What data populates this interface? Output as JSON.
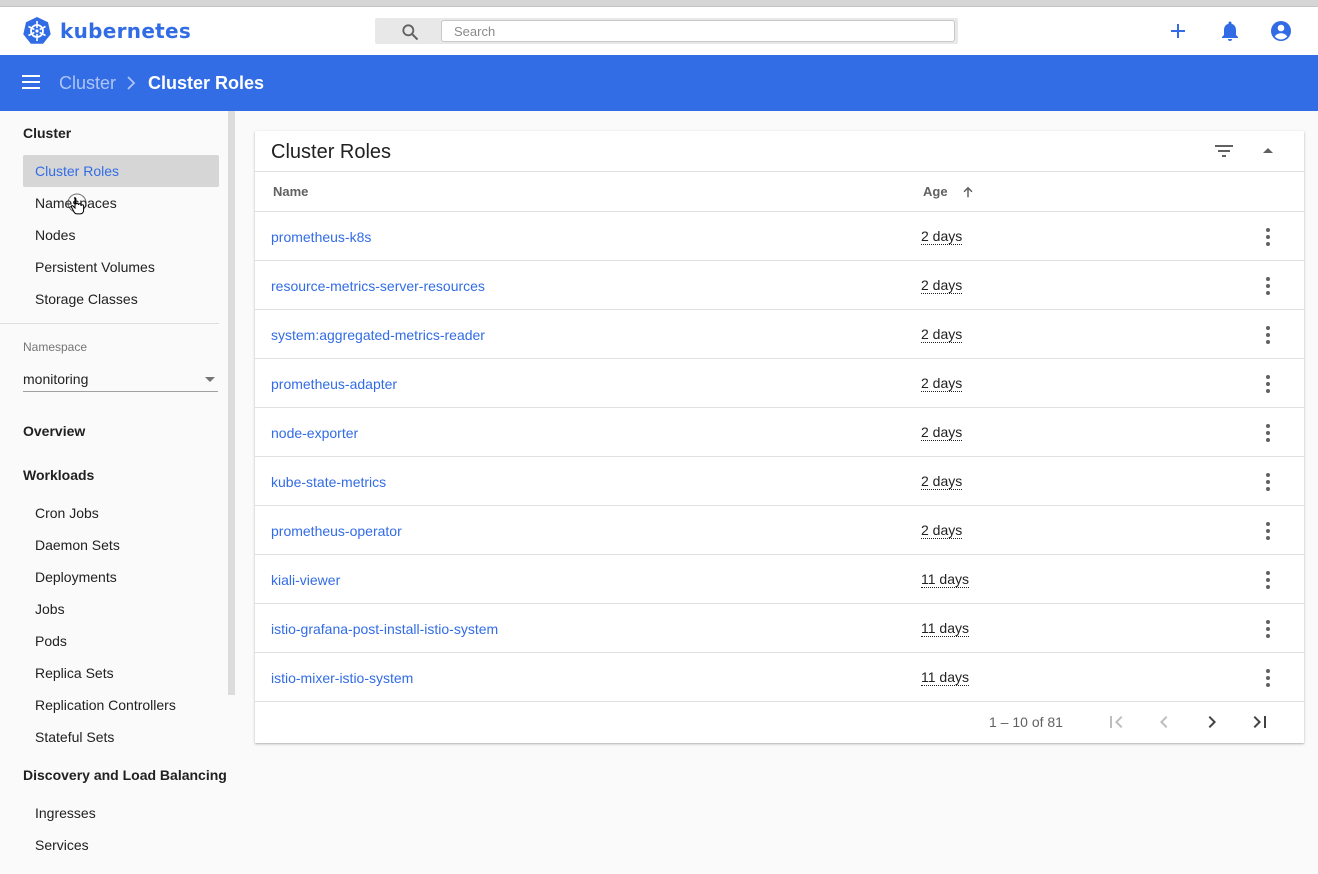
{
  "app": {
    "brand": "kubernetes",
    "search_placeholder": "Search"
  },
  "breadcrumb": {
    "parent": "Cluster",
    "current": "Cluster Roles"
  },
  "sidebar": {
    "cluster_heading": "Cluster",
    "cluster_items": [
      "Cluster Roles",
      "Namespaces",
      "Nodes",
      "Persistent Volumes",
      "Storage Classes"
    ],
    "active_item": "Cluster Roles",
    "namespace_label": "Namespace",
    "namespace_value": "monitoring",
    "overview": "Overview",
    "workloads_heading": "Workloads",
    "workloads_items": [
      "Cron Jobs",
      "Daemon Sets",
      "Deployments",
      "Jobs",
      "Pods",
      "Replica Sets",
      "Replication Controllers",
      "Stateful Sets"
    ],
    "discovery_heading": "Discovery and Load Balancing",
    "discovery_items": [
      "Ingresses",
      "Services"
    ]
  },
  "card": {
    "title": "Cluster Roles",
    "columns": {
      "name": "Name",
      "age": "Age"
    },
    "rows": [
      {
        "name": "prometheus-k8s",
        "age": "2 days"
      },
      {
        "name": "resource-metrics-server-resources",
        "age": "2 days"
      },
      {
        "name": "system:aggregated-metrics-reader",
        "age": "2 days"
      },
      {
        "name": "prometheus-adapter",
        "age": "2 days"
      },
      {
        "name": "node-exporter",
        "age": "2 days"
      },
      {
        "name": "kube-state-metrics",
        "age": "2 days"
      },
      {
        "name": "prometheus-operator",
        "age": "2 days"
      },
      {
        "name": "kiali-viewer",
        "age": "11 days"
      },
      {
        "name": "istio-grafana-post-install-istio-system",
        "age": "11 days"
      },
      {
        "name": "istio-mixer-istio-system",
        "age": "11 days"
      }
    ],
    "pager": {
      "range": "1 – 10 of 81"
    }
  },
  "colors": {
    "brand": "#326ce5",
    "toolbar": "#326de6",
    "active_bg": "#d6d6d6"
  },
  "icons": [
    "kubernetes-logo",
    "search-icon",
    "plus-icon",
    "bell-icon",
    "account-icon",
    "menu-icon",
    "chevron-right-icon",
    "filter-icon",
    "collapse-icon",
    "arrow-up-icon",
    "more-vert-icon",
    "first-page-icon",
    "prev-page-icon",
    "next-page-icon",
    "last-page-icon",
    "caret-down-icon",
    "hand-cursor-icon"
  ]
}
